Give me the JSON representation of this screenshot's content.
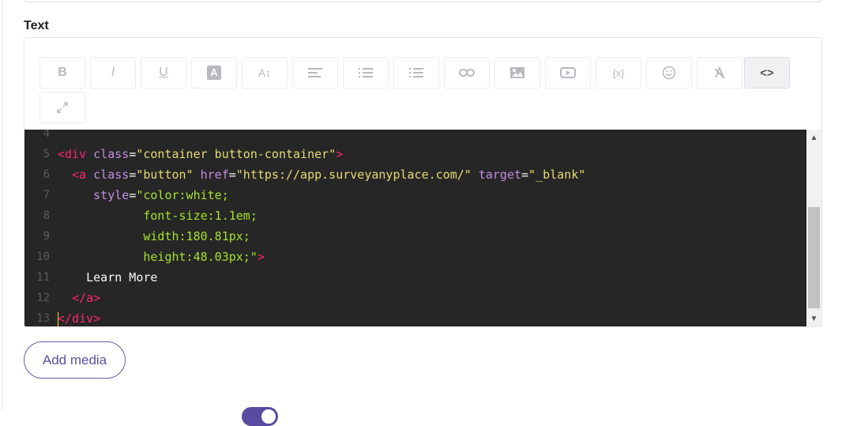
{
  "section": {
    "label": "Text"
  },
  "toolbar": {
    "buttons": [
      {
        "name": "bold",
        "icon": "bold-icon",
        "glyph": "B"
      },
      {
        "name": "italic",
        "icon": "italic-icon",
        "glyph": "I"
      },
      {
        "name": "underline",
        "icon": "underline-icon",
        "glyph": "U"
      },
      {
        "name": "text-color",
        "icon": "text-color-icon",
        "glyph": "A"
      },
      {
        "name": "font-size",
        "icon": "font-size-icon",
        "glyph": "A↕"
      },
      {
        "name": "align",
        "icon": "align-left-icon"
      },
      {
        "name": "ordered-list",
        "icon": "ordered-list-icon"
      },
      {
        "name": "unordered-list",
        "icon": "unordered-list-icon"
      },
      {
        "name": "link",
        "icon": "link-icon"
      },
      {
        "name": "image",
        "icon": "image-icon"
      },
      {
        "name": "video",
        "icon": "video-icon"
      },
      {
        "name": "variable",
        "icon": "variable-icon",
        "glyph": "{x}"
      },
      {
        "name": "emoji",
        "icon": "emoji-icon"
      },
      {
        "name": "clear-format",
        "icon": "clear-format-icon"
      },
      {
        "name": "code-view",
        "icon": "code-icon",
        "glyph": "<>",
        "active": true
      },
      {
        "name": "fullscreen",
        "icon": "expand-icon"
      }
    ]
  },
  "code_editor": {
    "lines": [
      {
        "number": "4",
        "tokens": []
      },
      {
        "number": "5",
        "tokens": [
          {
            "t": "tag",
            "v": "<div "
          },
          {
            "t": "attr",
            "v": "class"
          },
          {
            "t": "plain",
            "v": "="
          },
          {
            "t": "str",
            "v": "\"container button-container\""
          },
          {
            "t": "tag",
            "v": ">"
          }
        ]
      },
      {
        "number": "6",
        "tokens": [
          {
            "t": "plain",
            "v": "  "
          },
          {
            "t": "tag",
            "v": "<a "
          },
          {
            "t": "attr",
            "v": "class"
          },
          {
            "t": "plain",
            "v": "="
          },
          {
            "t": "str",
            "v": "\"button\""
          },
          {
            "t": "plain",
            "v": " "
          },
          {
            "t": "attr",
            "v": "href"
          },
          {
            "t": "plain",
            "v": "="
          },
          {
            "t": "str",
            "v": "\"https://app.surveyanyplace.com/\""
          },
          {
            "t": "plain",
            "v": " "
          },
          {
            "t": "attr",
            "v": "target"
          },
          {
            "t": "plain",
            "v": "="
          },
          {
            "t": "str",
            "v": "\"_blank\""
          }
        ]
      },
      {
        "number": "7",
        "tokens": [
          {
            "t": "plain",
            "v": "     "
          },
          {
            "t": "attr",
            "v": "style"
          },
          {
            "t": "plain",
            "v": "="
          },
          {
            "t": "strg",
            "v": "\"color:white;"
          }
        ]
      },
      {
        "number": "8",
        "tokens": [
          {
            "t": "plain",
            "v": "            "
          },
          {
            "t": "strg",
            "v": "font-size:1.1em;"
          }
        ]
      },
      {
        "number": "9",
        "tokens": [
          {
            "t": "plain",
            "v": "            "
          },
          {
            "t": "strg",
            "v": "width:180.81px;"
          }
        ]
      },
      {
        "number": "10",
        "tokens": [
          {
            "t": "plain",
            "v": "            "
          },
          {
            "t": "strg",
            "v": "height:48.03px;\""
          },
          {
            "t": "tag",
            "v": ">"
          }
        ]
      },
      {
        "number": "11",
        "tokens": [
          {
            "t": "plain",
            "v": "    Learn More"
          }
        ]
      },
      {
        "number": "12",
        "tokens": [
          {
            "t": "plain",
            "v": "  "
          },
          {
            "t": "tag",
            "v": "</a>"
          }
        ]
      },
      {
        "number": "13",
        "tokens": [
          {
            "t": "cursor",
            "v": ""
          },
          {
            "t": "tag",
            "v": "</div>"
          }
        ]
      }
    ]
  },
  "actions": {
    "add_media_label": "Add media"
  },
  "colors": {
    "accent": "#5d4fa0",
    "editor_bg": "#262626",
    "tag": "#f92672",
    "attr": "#c38de0",
    "string": "#e6db74"
  }
}
